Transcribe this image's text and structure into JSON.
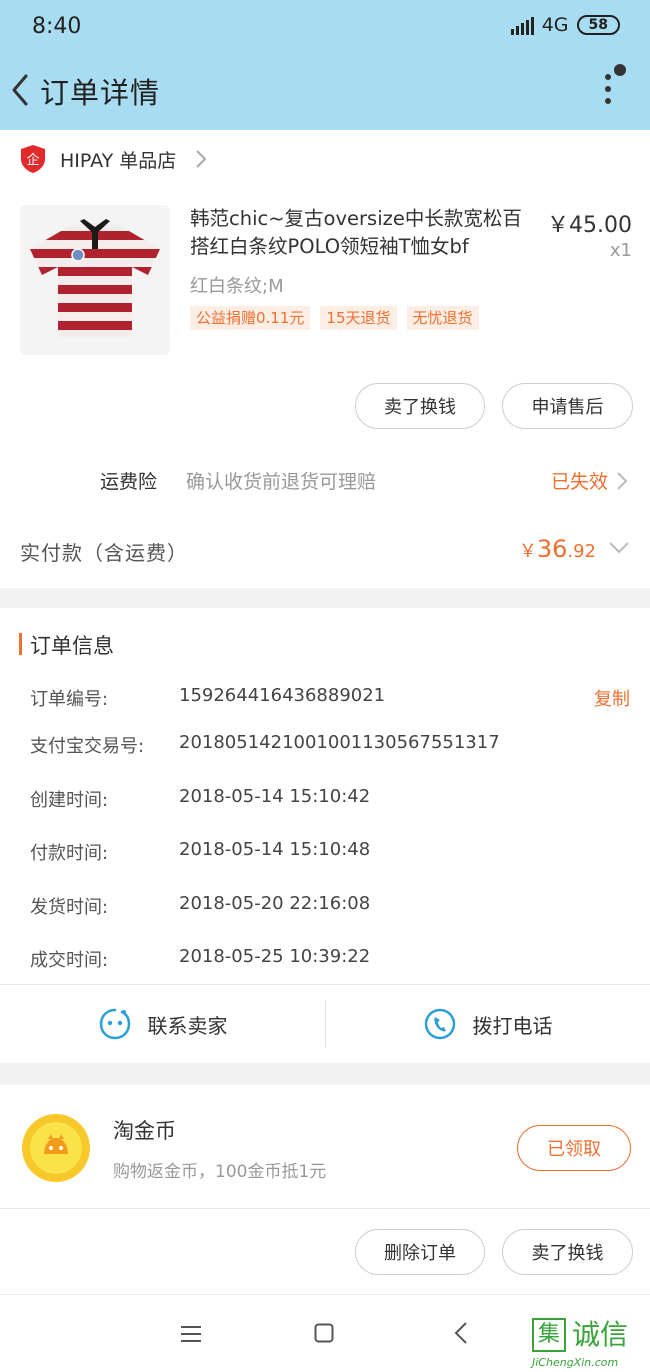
{
  "status_bar": {
    "time": "8:40",
    "network": "4G",
    "battery": "58"
  },
  "header": {
    "title": "订单详情"
  },
  "shop": {
    "name": "HIPAY 单品店"
  },
  "product": {
    "title": "韩范chic~复古oversize中长款宽松百搭红白条纹POLO领短袖T恤女bf",
    "price": "￥45.00",
    "qty": "x1",
    "sku": "红白条纹;M",
    "tags": [
      "公益捐赠0.11元",
      "15天退货",
      "无忧退货"
    ]
  },
  "actions_top": {
    "sell": "卖了换钱",
    "after_sale": "申请售后"
  },
  "insurance": {
    "label": "运费险",
    "desc": "确认收货前退货可理赔",
    "status": "已失效"
  },
  "payment": {
    "label": "实付款（含运费）",
    "currency": "￥",
    "amount_int": "36",
    "amount_dec": ".92"
  },
  "order_info": {
    "title": "订单信息",
    "copy_label": "复制",
    "rows": [
      {
        "key": "订单编号:",
        "value": "159264416436889021"
      },
      {
        "key": "支付宝交易号:",
        "value": "2018051421001001130567551317"
      },
      {
        "key": "创建时间:",
        "value": "2018-05-14 15:10:42"
      },
      {
        "key": "付款时间:",
        "value": "2018-05-14 15:10:48"
      },
      {
        "key": "发货时间:",
        "value": "2018-05-20 22:16:08"
      },
      {
        "key": "成交时间:",
        "value": "2018-05-25 10:39:22"
      }
    ]
  },
  "contact": {
    "seller": "联系卖家",
    "call": "拨打电话"
  },
  "coins": {
    "title": "淘金币",
    "desc": "购物返金币，100金币抵1元",
    "button": "已领取"
  },
  "actions_bottom": {
    "delete": "删除订单",
    "sell": "卖了换钱"
  },
  "watermark": {
    "logo": "集",
    "brand": "诚信",
    "url": "JiChengXin.com"
  },
  "colors": {
    "accent": "#f07030",
    "header_bg": "#a8dcf0",
    "tag_bg": "#fdeee5",
    "contact_icon": "#2a9fd8"
  },
  "icons": [
    "back-icon",
    "more-icon",
    "shop-logo-icon",
    "chevron-right-icon",
    "chevron-down-icon",
    "chat-icon",
    "phone-icon",
    "coin-icon",
    "menu-icon",
    "home-icon",
    "nav-back-icon"
  ]
}
